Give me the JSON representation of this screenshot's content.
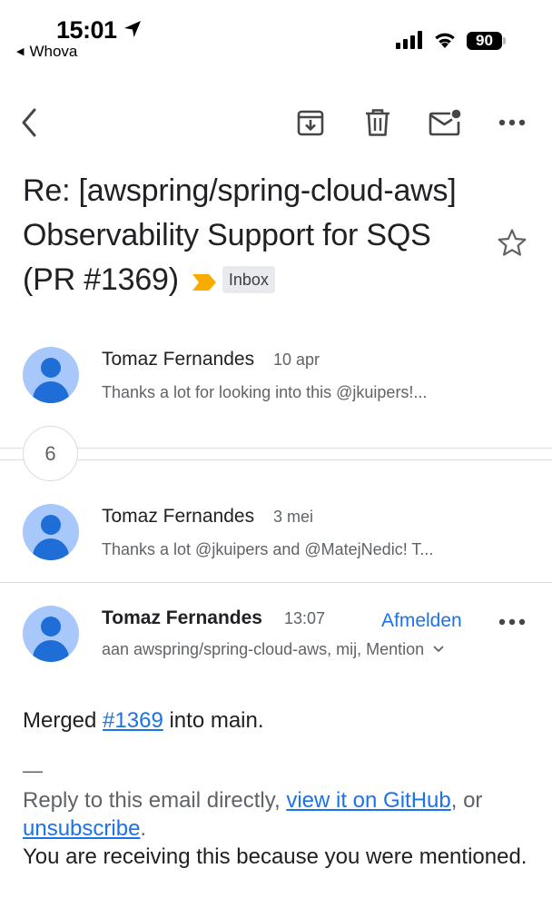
{
  "status_bar": {
    "time": "15:01",
    "back_app": "Whova",
    "battery": "90"
  },
  "toolbar": {
    "icons": [
      "back-icon",
      "archive-icon",
      "delete-icon",
      "mark-unread-icon",
      "more-icon"
    ]
  },
  "subject": {
    "text": "Re: [awspring/spring-cloud-aws] Observability Support for SQS (PR #1369)",
    "label": "Inbox",
    "importance_color": "#f9ab00"
  },
  "messages": [
    {
      "sender": "Tomaz Fernandes",
      "date": "10 apr",
      "snippet": "Thanks a lot for looking into this @jkuipers!..."
    },
    {
      "sender": "Tomaz Fernandes",
      "date": "3 mei",
      "snippet": "Thanks a lot @jkuipers and @MatejNedic! T..."
    }
  ],
  "collapsed_count": "6",
  "open_message": {
    "sender": "Tomaz Fernandes",
    "time": "13:07",
    "unsubscribe_label": "Afmelden",
    "recipients": "aan awspring/spring-cloud-aws, mij, Mention",
    "body": {
      "prefix": "Merged ",
      "link": "#1369",
      "suffix": " into main."
    },
    "signature_dash": "—",
    "footer": {
      "reply_text": "Reply to this email directly, ",
      "view_link": "view it on GitHub",
      "or_text": ", or",
      "unsubscribe_link": "unsubscribe",
      "period": ".",
      "receiving_text": "You are receiving this because you were mentioned."
    }
  },
  "colors": {
    "accent": "#1a73e8",
    "avatar_bg": "#a8c7fa",
    "avatar_fg": "#1f6dd6"
  }
}
